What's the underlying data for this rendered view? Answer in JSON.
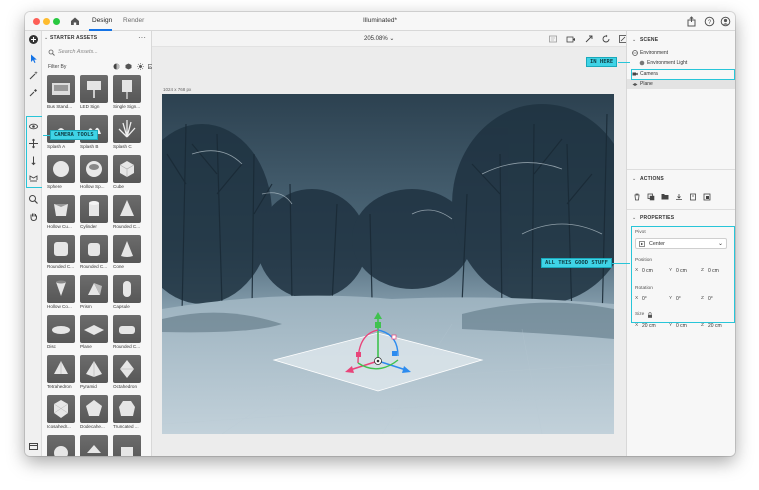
{
  "window": {
    "doc_title": "Illuminated*",
    "tabs": [
      {
        "label": "Design",
        "active": true
      },
      {
        "label": "Render",
        "active": false
      }
    ]
  },
  "rail": {
    "tools": [
      "add-icon",
      "select-icon",
      "magic-wand-icon",
      "eyedropper-icon",
      "orbit-camera-icon",
      "pan-camera-icon",
      "dolly-camera-icon",
      "bookmark-camera-icon",
      "zoom-icon",
      "hand-icon",
      "layers-icon"
    ]
  },
  "assets": {
    "title": "STARTER ASSETS",
    "search_placeholder": "Search Assets...",
    "filter_label": "Filter By",
    "items": [
      {
        "label": "Bus Stand...",
        "shape": "bus"
      },
      {
        "label": "LED Sign",
        "shape": "sign"
      },
      {
        "label": "Single Sign...",
        "shape": "sign2"
      },
      {
        "label": "Splash A",
        "shape": "splash"
      },
      {
        "label": "Splash B",
        "shape": "splash2"
      },
      {
        "label": "Splash C",
        "shape": "splash3"
      },
      {
        "label": "Sphere",
        "shape": "sphere"
      },
      {
        "label": "Hollow Sp...",
        "shape": "hsphere"
      },
      {
        "label": "Cube",
        "shape": "cube"
      },
      {
        "label": "Hollow Cu...",
        "shape": "hcube"
      },
      {
        "label": "Cylinder",
        "shape": "cylinder"
      },
      {
        "label": "Rounded C...",
        "shape": "cone"
      },
      {
        "label": "Rounded C...",
        "shape": "rcube"
      },
      {
        "label": "Rounded C...",
        "shape": "rcyl"
      },
      {
        "label": "Cone",
        "shape": "cone2"
      },
      {
        "label": "Hollow Co...",
        "shape": "hcone"
      },
      {
        "label": "Prism",
        "shape": "prism"
      },
      {
        "label": "Capsule",
        "shape": "capsule"
      },
      {
        "label": "Disc",
        "shape": "disc"
      },
      {
        "label": "Plane",
        "shape": "plane"
      },
      {
        "label": "Rounded C...",
        "shape": "rplane"
      },
      {
        "label": "Tetrahedron",
        "shape": "tetra"
      },
      {
        "label": "Pyramid",
        "shape": "pyramid"
      },
      {
        "label": "Octahedron",
        "shape": "octa"
      },
      {
        "label": "Icosahedr...",
        "shape": "icosa"
      },
      {
        "label": "Dodecahe...",
        "shape": "dodeca"
      },
      {
        "label": "Truncated ...",
        "shape": "trunc"
      },
      {
        "label": "",
        "shape": "more1"
      },
      {
        "label": "",
        "shape": "more2"
      },
      {
        "label": "",
        "shape": "more3"
      }
    ]
  },
  "canvas": {
    "zoom": "205.08%",
    "size_label": "1024 x 768 px"
  },
  "scene": {
    "title": "SCENE",
    "items": [
      {
        "label": "Environment",
        "indent": 0,
        "icon": "environment-icon"
      },
      {
        "label": "Environment Light",
        "indent": 1,
        "icon": "light-icon"
      },
      {
        "label": "Camera",
        "indent": 0,
        "icon": "camera-icon"
      },
      {
        "label": "Plane",
        "indent": 0,
        "icon": "plane-icon",
        "selected": true
      }
    ]
  },
  "actions": {
    "title": "ACTIONS"
  },
  "properties": {
    "title": "PROPERTIES",
    "pivot_label": "Pivot",
    "pivot_value": "Center",
    "position_label": "Position",
    "position": {
      "x": "0 cm",
      "y": "0 cm",
      "z": "0 cm"
    },
    "rotation_label": "Rotation",
    "rotation": {
      "x": "0°",
      "y": "0°",
      "z": "0°"
    },
    "size_label": "Size",
    "size": {
      "x": "20 cm",
      "y": "0 cm",
      "z": "20 cm"
    },
    "axis_x": "X",
    "axis_y": "Y",
    "axis_z": "Z"
  },
  "callouts": {
    "in_here": "IN HERE",
    "camera_tools": "CAMERA TOOLS",
    "good_stuff": "ALL THIS GOOD STUFF"
  },
  "colors": {
    "accent": "#1473e6",
    "callout": "#3fd3e6",
    "gizmo_x": "#e8457a",
    "gizmo_y": "#3fc24e",
    "gizmo_z": "#2c8bef"
  }
}
